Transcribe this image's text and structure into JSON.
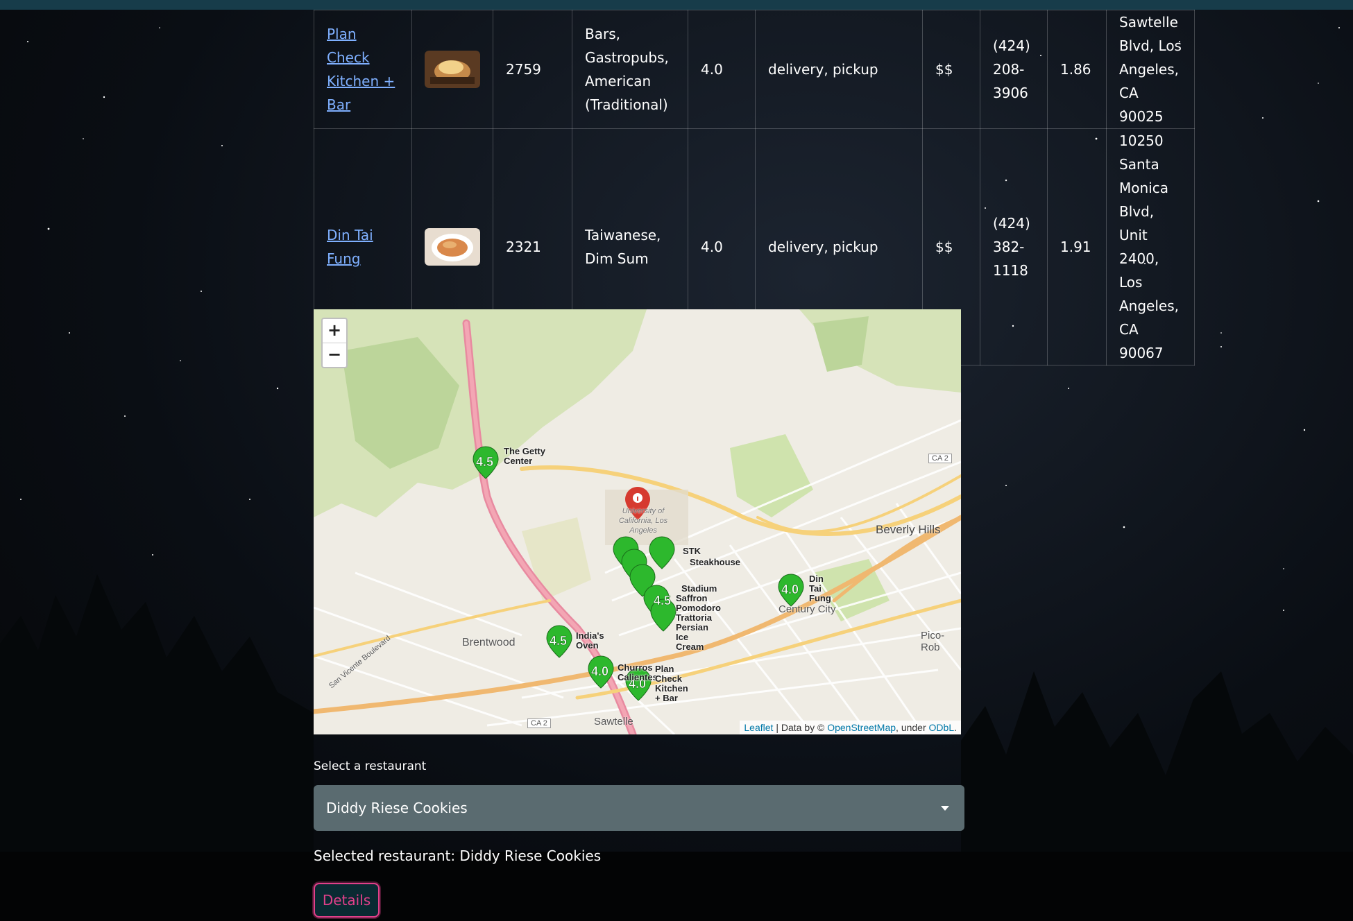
{
  "table": {
    "rows": [
      {
        "name": "Plan Check Kitchen + Bar",
        "review_count": "2759",
        "categories": "Bars, Gastropubs, American (Traditional)",
        "rating": "4.0",
        "transactions": "delivery, pickup",
        "price": "$$",
        "phone": "(424) 208-3906",
        "distance": "1.86",
        "address": "Sawtelle Blvd, Los Angeles, CA 90025"
      },
      {
        "name": "Din Tai Fung",
        "review_count": "2321",
        "categories": "Taiwanese, Dim Sum",
        "rating": "4.0",
        "transactions": "delivery, pickup",
        "price": "$$",
        "phone": "(424) 382-1118",
        "distance": "1.91",
        "address": "10250 Santa Monica Blvd, Unit 2400, Los Angeles, CA 90067"
      }
    ]
  },
  "map": {
    "zoom_in": "+",
    "zoom_out": "−",
    "places": {
      "beverly_hills": "Beverly Hills",
      "century_city": "Century City",
      "brentwood": "Brentwood",
      "sawtelle": "Sawtelle",
      "pico": "Pico-Rob",
      "ucla": "University of California, Los Angeles",
      "ca2_a": "CA 2",
      "ca2_b": "CA 2",
      "san_vicente": "San Vicente Boulevard"
    },
    "markers": [
      {
        "label": "4.5",
        "name": "The Getty Center"
      },
      {
        "label": "4.0",
        "name": "Din Tai Fung"
      },
      {
        "label": "4.5",
        "name": "India's Oven"
      },
      {
        "label": "4.0",
        "name": "Churros Calientes"
      },
      {
        "label": "4.0",
        "name": "Plan Check Kitchen + Bar"
      },
      {
        "label": "4.5",
        "name": "Trattoria Pomodoro"
      },
      {
        "label": "4.5",
        "name": "Saffron Persian Ice Cream"
      }
    ],
    "cluster_labels": {
      "stk": "STK",
      "steakhouse": "Steakhouse",
      "stadium": "Stadium",
      "saffron": "Saffron",
      "pomodoro": "Pomodoro",
      "trattoria": "Trattoria",
      "persian": "Persian",
      "ice": "Ice",
      "cream": "Cream"
    },
    "attribution": {
      "leaflet": "Leaflet",
      "text1": " | Data by © ",
      "osm": "OpenStreetMap",
      "text2": ", under ",
      "odbl": "ODbL",
      "text3": "."
    }
  },
  "controls": {
    "select_label": "Select a restaurant",
    "selected_value": "Diddy Riese Cookies",
    "selected_text": "Selected restaurant: Diddy Riese Cookies",
    "details_button": "Details"
  },
  "colors": {
    "marker_green": "#2db82d",
    "link": "#7fb0ff",
    "button_accent": "#e0408a",
    "select_bg": "#5a6b70"
  }
}
